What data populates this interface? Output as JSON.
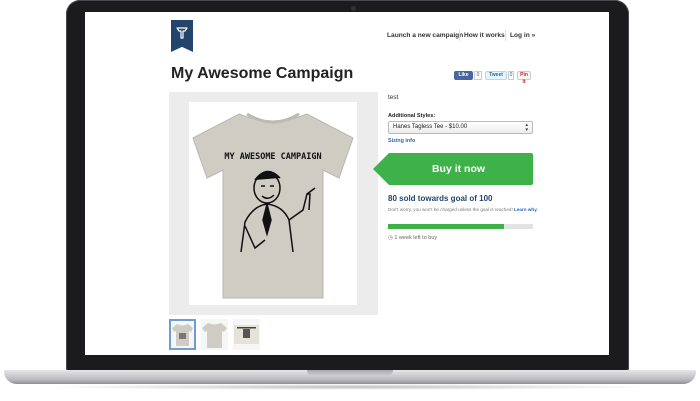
{
  "header": {
    "nav": [
      "Launch a new campaign",
      "How it works",
      "Log in »"
    ]
  },
  "campaign": {
    "title": "My Awesome Campaign",
    "description": "test",
    "shirt_text": "MY AWESOME CAMPAIGN"
  },
  "share": {
    "facebook_label": "Like",
    "facebook_count": "0",
    "twitter_label": "Tweet",
    "twitter_count": "0",
    "pinterest_label": "Pin it"
  },
  "purchase": {
    "styles_label": "Additional Styles:",
    "selected_style": "Hanes Tagless Tee - $10.00",
    "sizing_link": "Sizing info",
    "buy_button": "Buy it now"
  },
  "progress": {
    "headline": "80 sold towards goal of 100",
    "note": "Don't worry, you won't be charged unless the goal is reached!",
    "learn_link": "Learn why.",
    "sold": 80,
    "goal": 100,
    "time_left": "1 week left to buy"
  },
  "colors": {
    "brand_navy": "#23446b",
    "buy_green": "#3eb249",
    "link_blue": "#2a68b6",
    "shirt": "#cfccc4"
  },
  "icons": [
    "logo-icon",
    "clock-icon",
    "select-arrows-icon"
  ]
}
